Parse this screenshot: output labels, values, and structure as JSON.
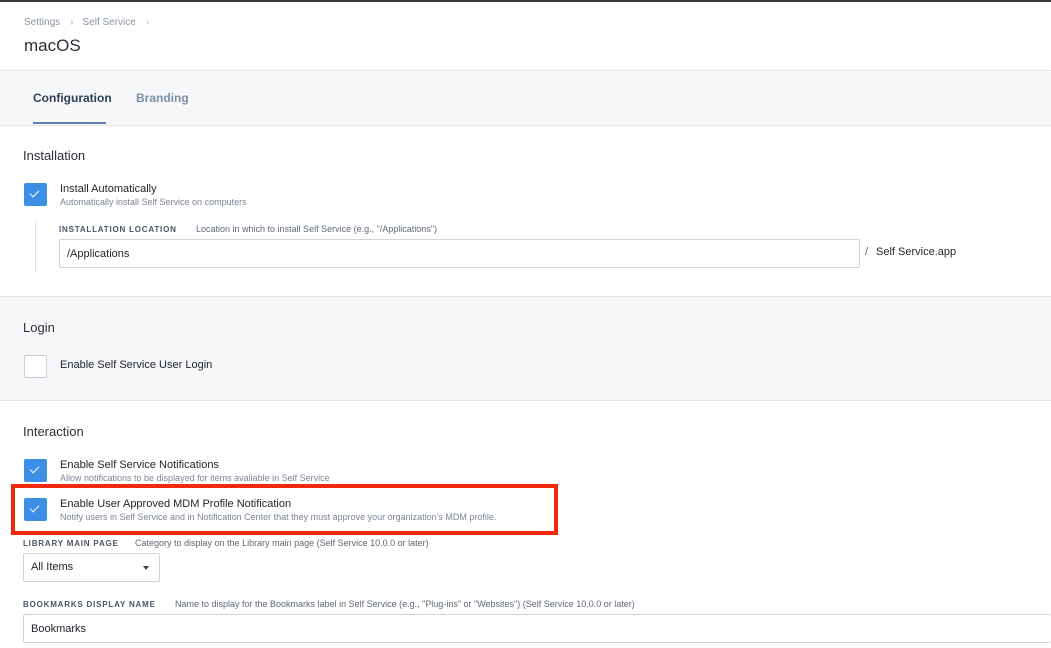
{
  "breadcrumb": {
    "items": [
      "Settings",
      "Self Service"
    ]
  },
  "page": {
    "title": "macOS"
  },
  "tabs": [
    {
      "label": "Configuration",
      "active": true
    },
    {
      "label": "Branding",
      "active": false
    }
  ],
  "installation": {
    "title": "Installation",
    "install_auto": {
      "label": "Install Automatically",
      "description": "Automatically install Self Service on computers",
      "checked": true
    },
    "location": {
      "label": "INSTALLATION LOCATION",
      "description": "Location in which to install Self Service (e.g., \"/Applications\")",
      "value": "/Applications",
      "separator": "/",
      "suffix": "Self Service.app"
    }
  },
  "login": {
    "title": "Login",
    "enable_login": {
      "label": "Enable Self Service User Login",
      "checked": false
    }
  },
  "interaction": {
    "title": "Interaction",
    "notifications": {
      "label": "Enable Self Service Notifications",
      "description": "Allow notifications to be displayed for items available in Self Service",
      "checked": true
    },
    "mdm_notification": {
      "label": "Enable User Approved MDM Profile Notification",
      "description": "Notify users in Self Service and in Notification Center that they must approve your organization's MDM profile.",
      "checked": true
    },
    "library_main_page": {
      "label": "LIBRARY MAIN PAGE",
      "description": "Category to display on the Library main page (Self Service 10.0.0 or later)",
      "selected": "All Items"
    },
    "bookmarks_name": {
      "label": "BOOKMARKS DISPLAY NAME",
      "description": "Name to display for the Bookmarks label in Self Service (e.g., \"Plug-ins\" or \"Websites\") (Self Service 10.0.0 or later)",
      "value": "Bookmarks"
    }
  },
  "colors": {
    "accent": "#3d8ee6",
    "highlight": "#f22a0c",
    "tab_underline": "#5d7ea6"
  }
}
